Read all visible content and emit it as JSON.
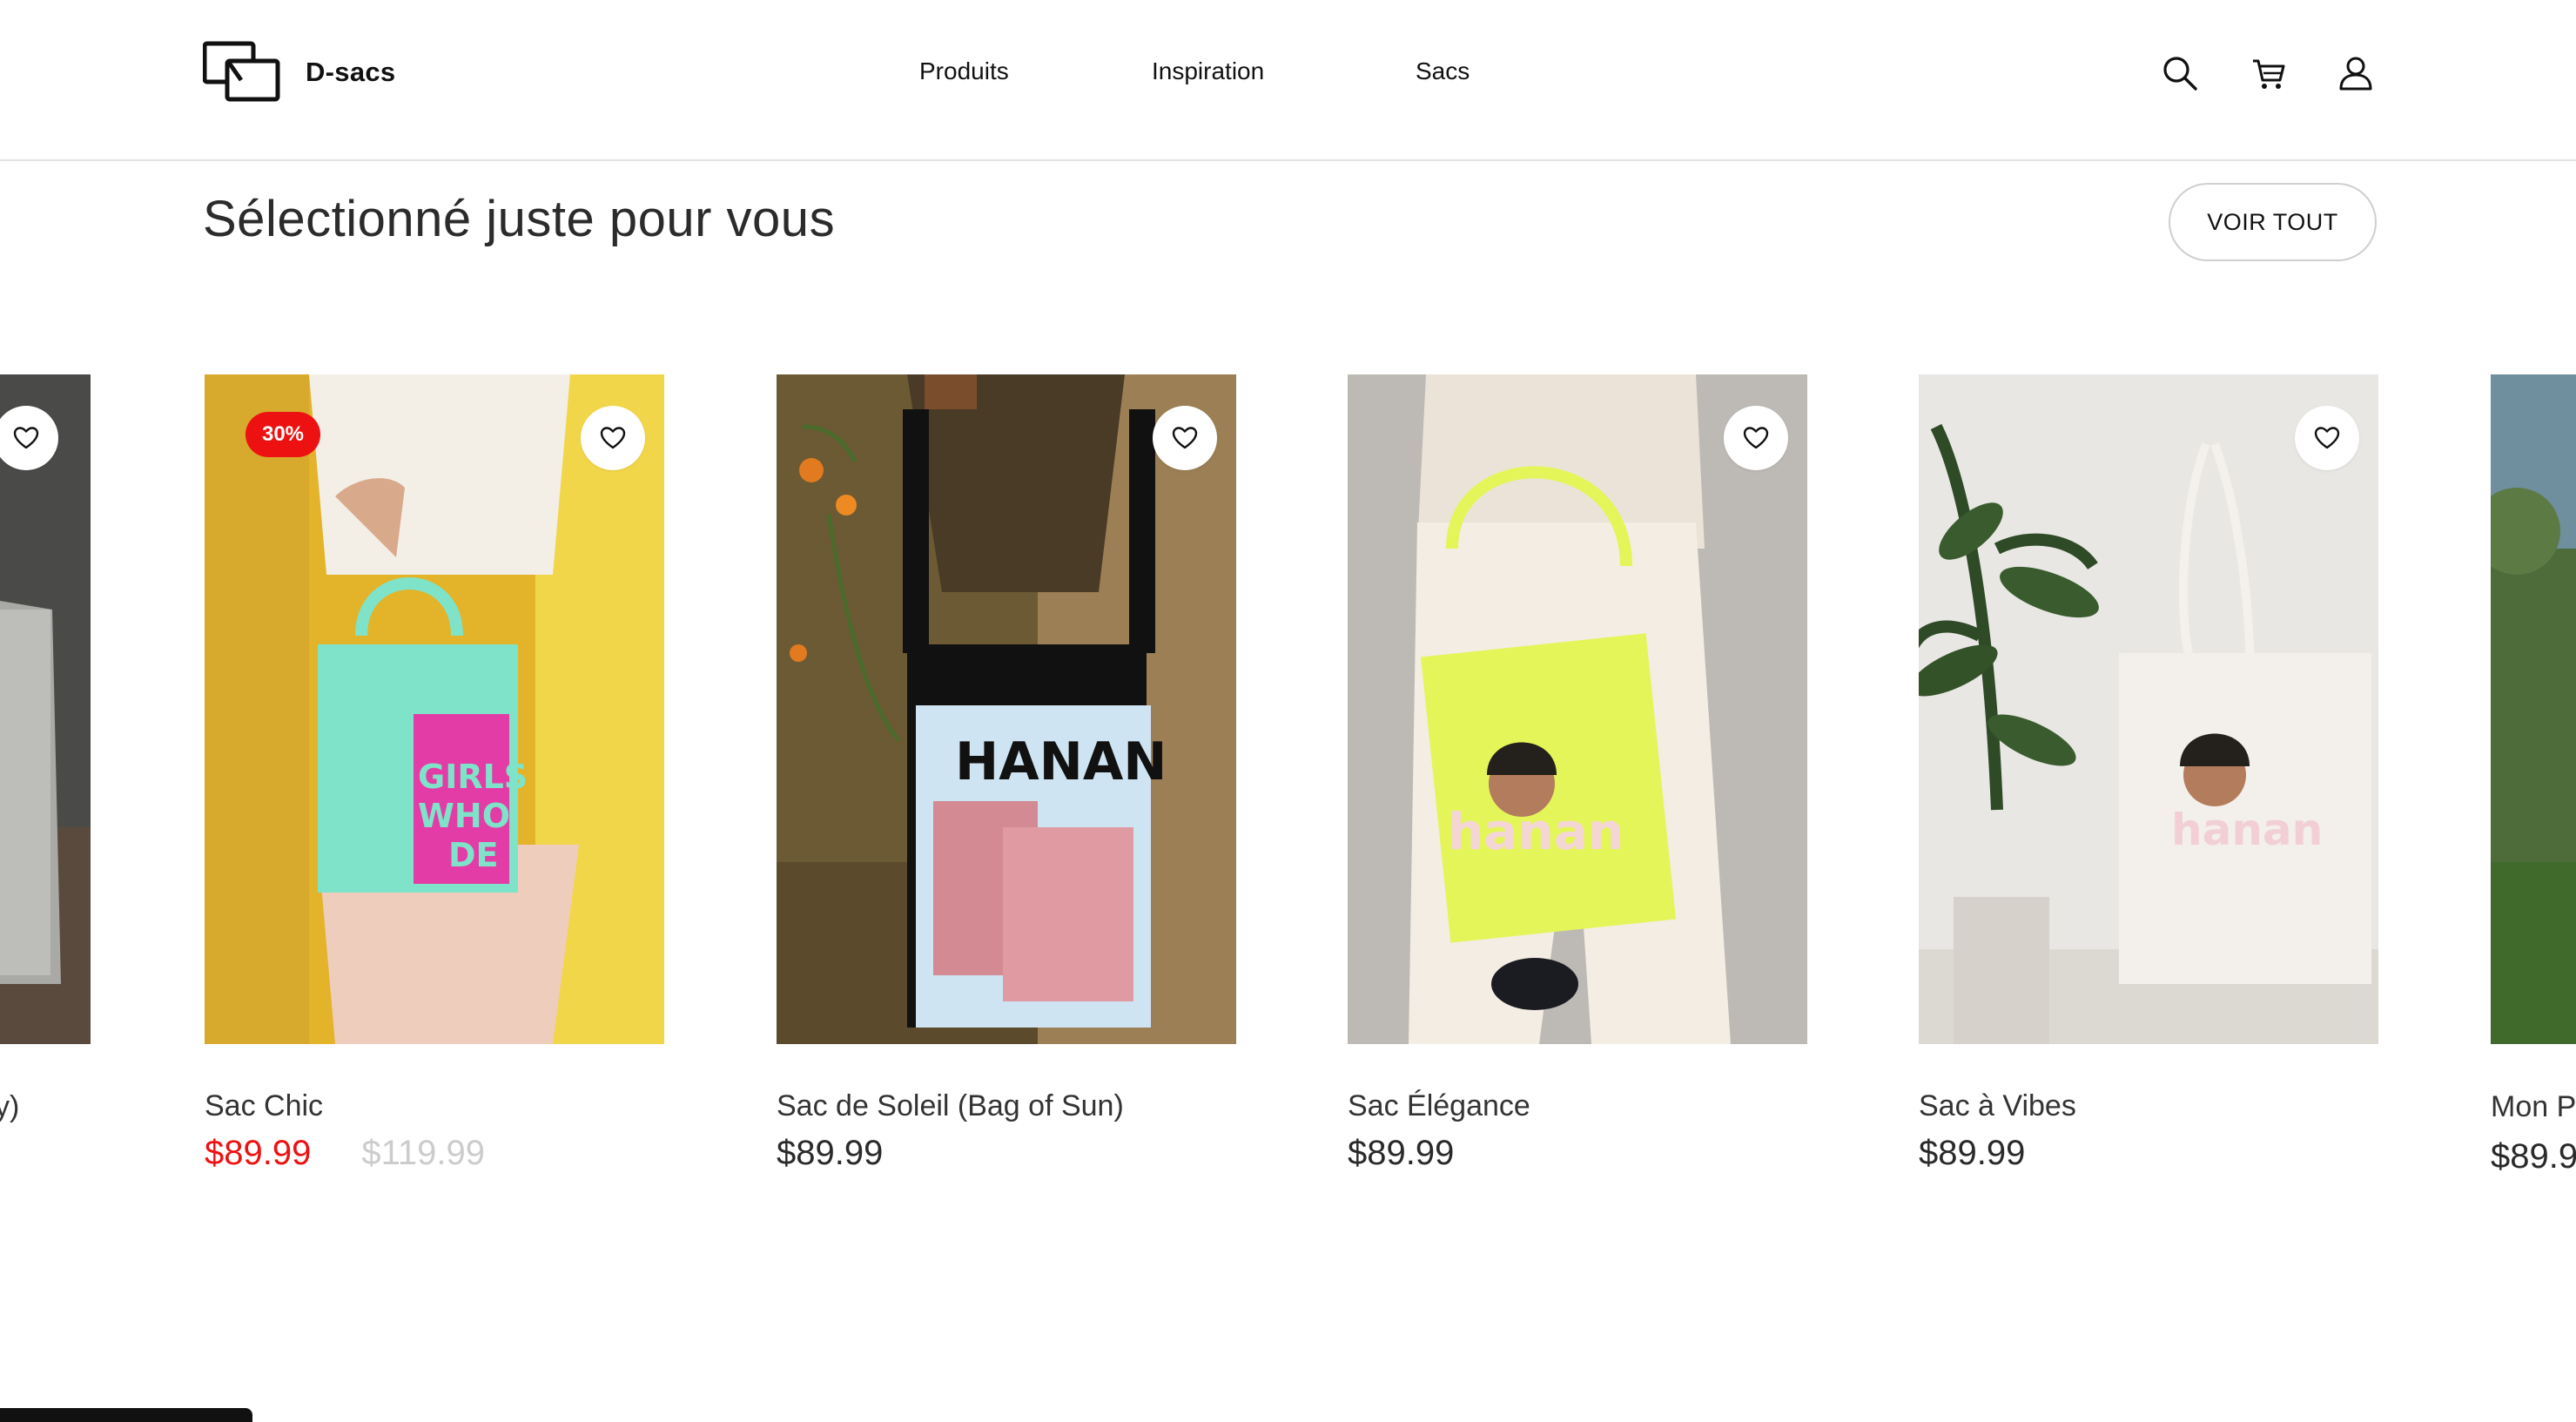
{
  "header": {
    "brand": "D-sacs",
    "nav": [
      "Produits",
      "Inspiration",
      "Sacs"
    ],
    "icons": [
      "search-icon",
      "cart-icon",
      "user-icon"
    ]
  },
  "section": {
    "title": "Sélectionné juste pour vous",
    "view_all": "VOIR TOUT"
  },
  "products": [
    {
      "name": "Sac Chic",
      "price": "$89.99",
      "old_price": "$119.99",
      "badge": "30%",
      "on_sale": true
    },
    {
      "name": "Sac de Soleil (Bag of Sun)",
      "price": "$89.99"
    },
    {
      "name": "Sac Élégance",
      "price": "$89.99"
    },
    {
      "name": "Sac à Vibes",
      "price": "$89.99"
    }
  ],
  "partial_left": {
    "name_fragment": "y)"
  },
  "partial_right": {
    "name_fragment": "Mon Pe",
    "price_fragment": "$89.9"
  },
  "colors": {
    "sale_red": "#ee1111",
    "old_price_gray": "#cccccc",
    "accent_mint": "#7fe3c9",
    "accent_lime": "#e4f55a"
  }
}
